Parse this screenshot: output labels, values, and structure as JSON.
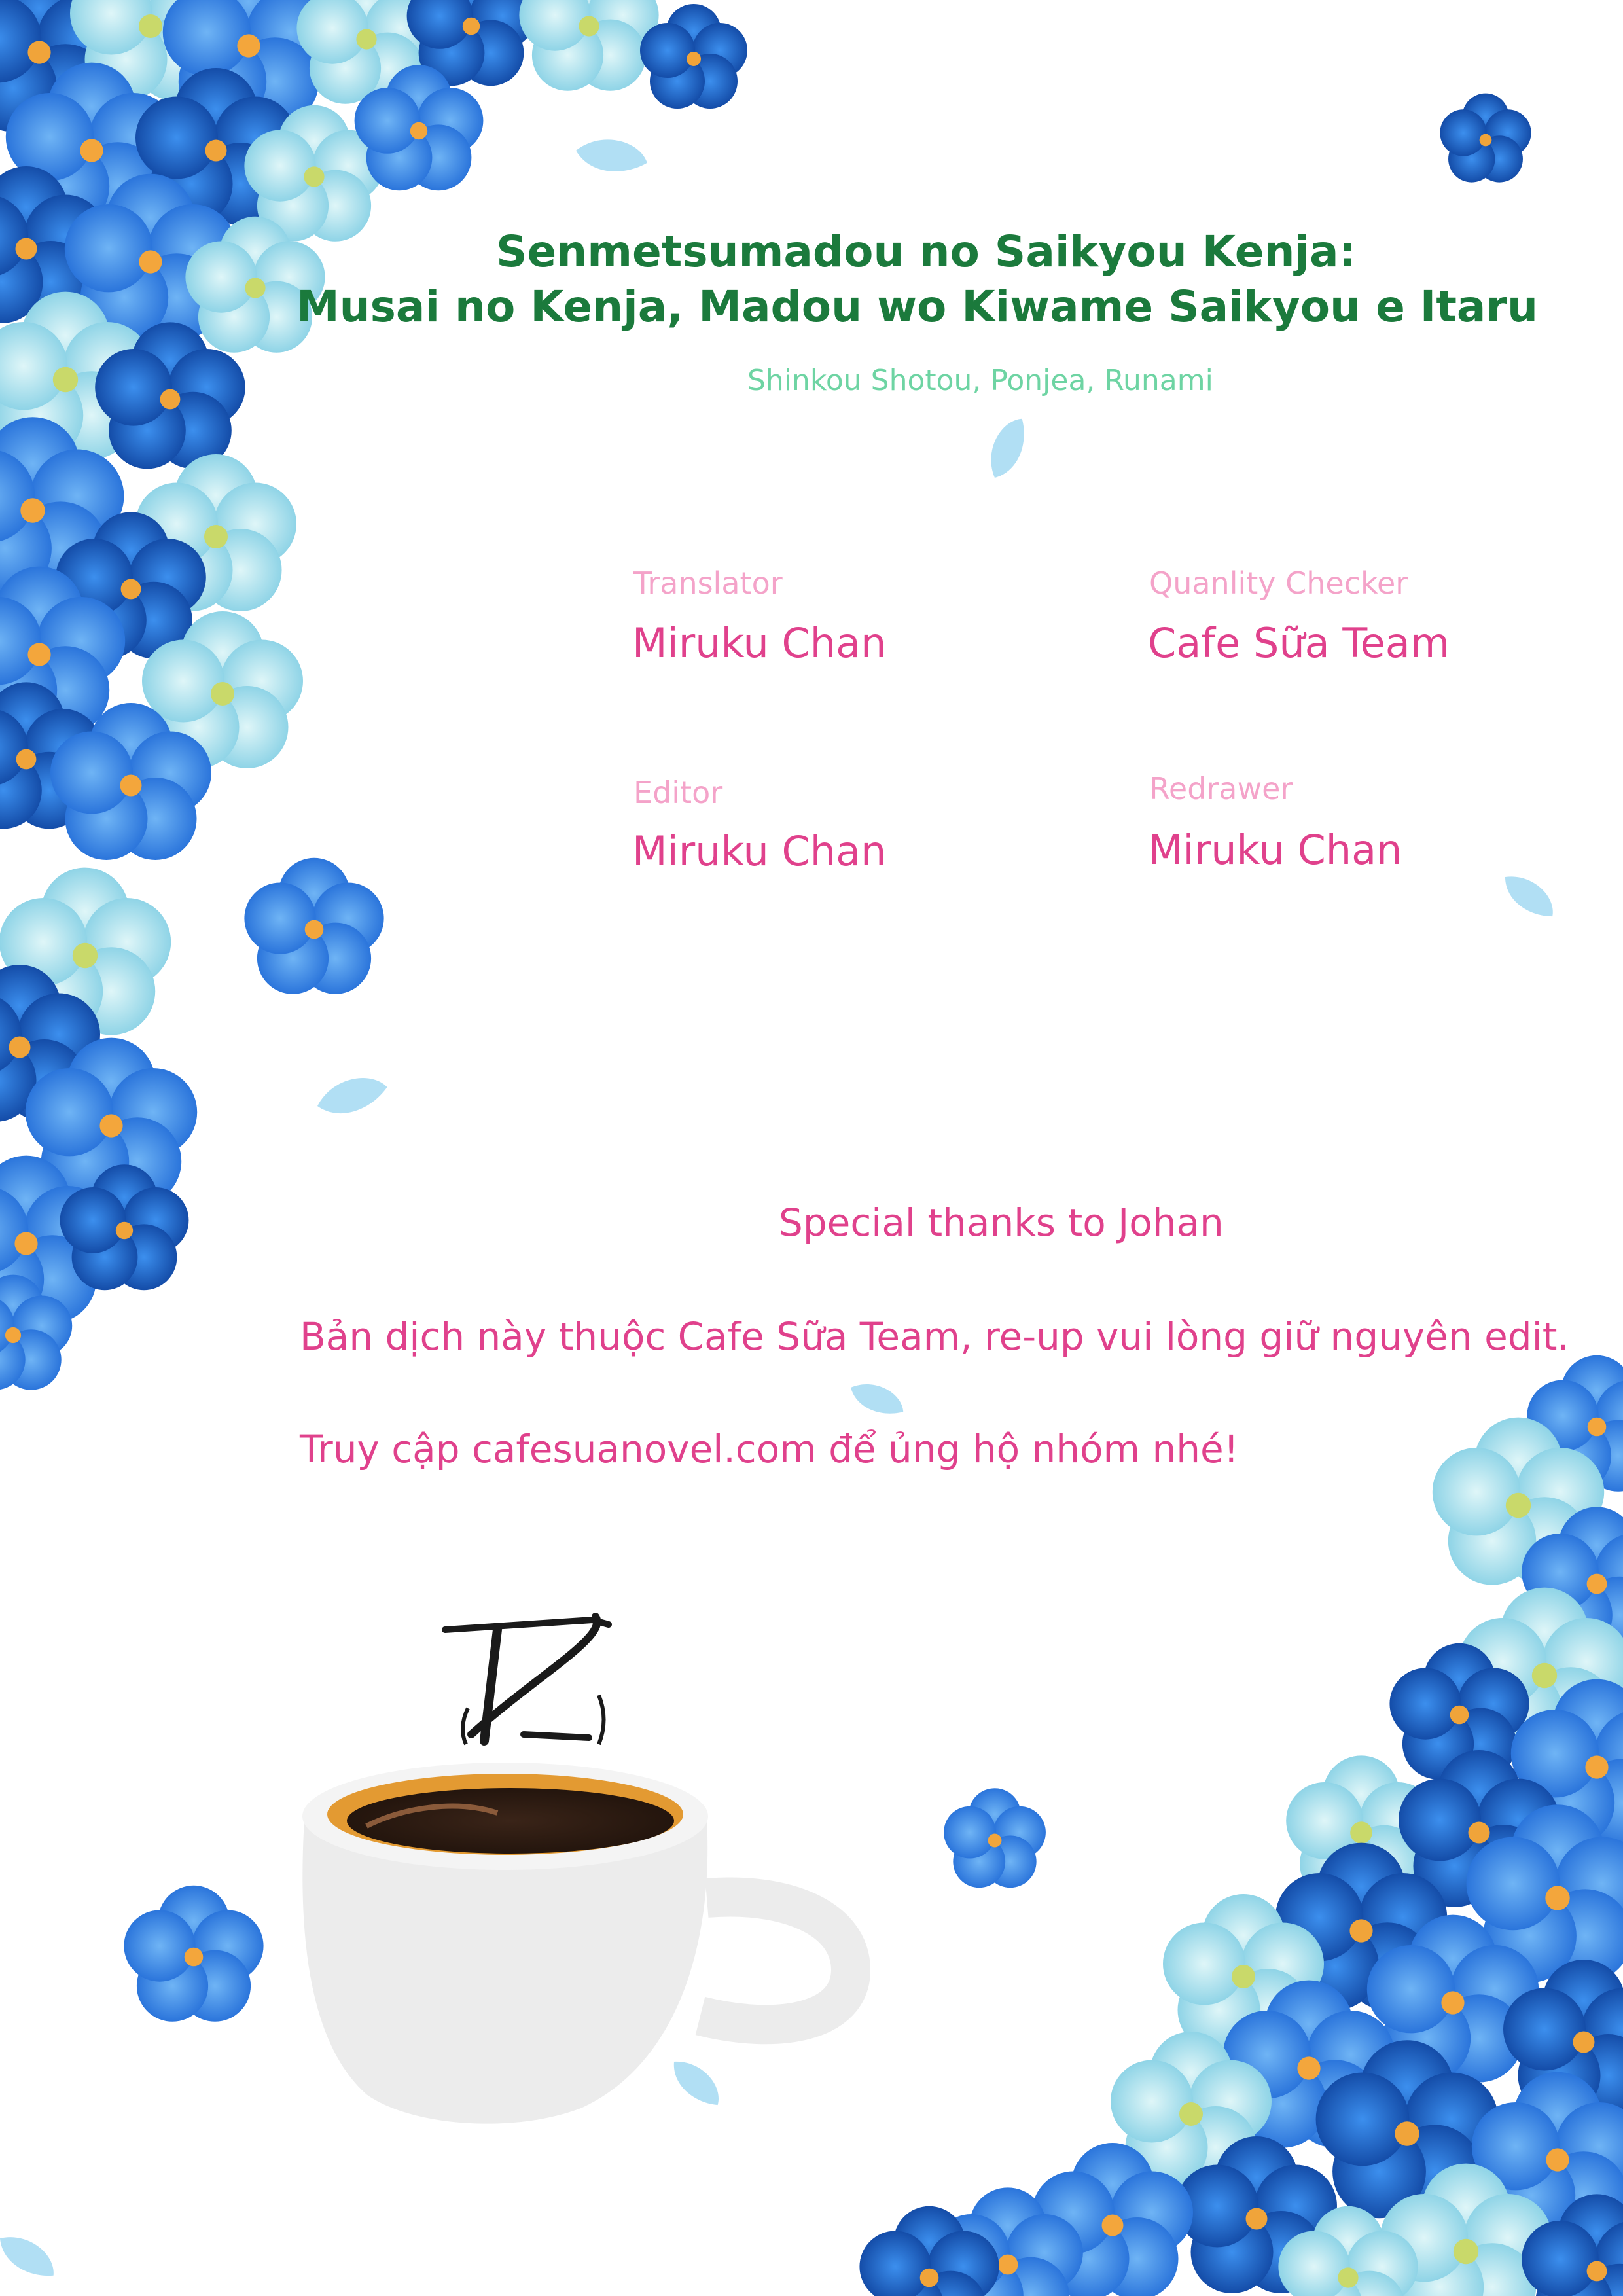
{
  "title": {
    "line1": "Senmetsumadou no Saikyou Kenja:",
    "line2": "Musai no Kenja, Madou wo Kiwame Saikyou e Itaru"
  },
  "authors": "Shinkou Shotou, Ponjea, Runami",
  "credits": [
    {
      "role": "Translator",
      "name": "Miruku Chan"
    },
    {
      "role": "Quanlity Checker",
      "name": "Cafe Sữa Team"
    },
    {
      "role": "Editor",
      "name": "Miruku Chan"
    },
    {
      "role": "Redrawer",
      "name": "Miruku Chan"
    }
  ],
  "thanks": {
    "special": "Special thanks to Johan",
    "notice": "Bản dịch này thuộc Cafe Sữa Team, re-up vui lòng giữ nguyên edit.",
    "visit": "Truy cập cafesuanovel.com để ủng hộ nhóm nhé!"
  },
  "colors": {
    "title": "#1b7a3c",
    "authors": "#6ed4a3",
    "role": "#f4a3c9",
    "name": "#e0418c",
    "flower_dark": "#0f4fae",
    "flower_mid": "#2a7be0",
    "flower_light": "#8fd6e6"
  },
  "icons": [
    "flower-cluster-top-left",
    "flower-cluster-bottom-right",
    "coffee-cup-logo",
    "petal-icon"
  ]
}
